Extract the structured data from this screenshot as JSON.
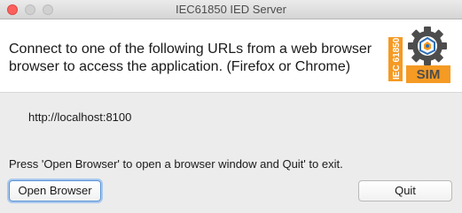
{
  "window": {
    "title": "IEC61850 IED Server",
    "controls": [
      "close",
      "minimize",
      "maximize"
    ]
  },
  "header": {
    "line1": "Connect to one of the following URLs from a web browser",
    "line2": "browser to access the application. (Firefox or Chrome)",
    "logo": {
      "icon": "gear-icon",
      "vertical_text": "IEC 61850",
      "badge_text": "SIM",
      "colors": {
        "gear": "#4d4d4d",
        "accent": "#f59a23",
        "inner": "#2e6fb5"
      }
    }
  },
  "body": {
    "url": "http://localhost:8100",
    "hint": "Press 'Open Browser' to open a browser window and Quit' to exit."
  },
  "buttons": {
    "open_browser": "Open Browser",
    "quit": "Quit"
  }
}
